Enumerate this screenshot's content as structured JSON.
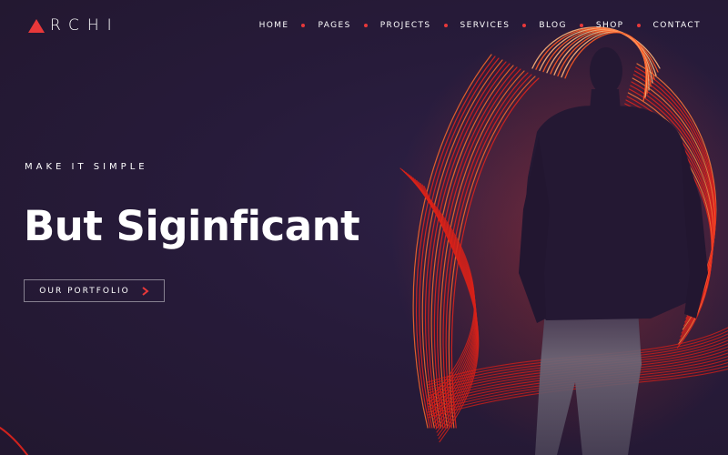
{
  "brand": {
    "name": "RCHI",
    "accent": "#e8383a",
    "background": "#261a38"
  },
  "nav": {
    "items": [
      {
        "label": "HOME"
      },
      {
        "label": "PAGES"
      },
      {
        "label": "PROJECTS"
      },
      {
        "label": "SERVICES"
      },
      {
        "label": "BLOG"
      },
      {
        "label": "SHOP"
      },
      {
        "label": "CONTACT"
      }
    ],
    "separator_icon": "dot-icon"
  },
  "hero": {
    "kicker": "MAKE IT SIMPLE",
    "headline": "But Siginficant",
    "cta_label": "OUR PORTFOLIO",
    "cta_icon": "chevron-right-icon",
    "image": "silhouette-with-light-trails"
  }
}
